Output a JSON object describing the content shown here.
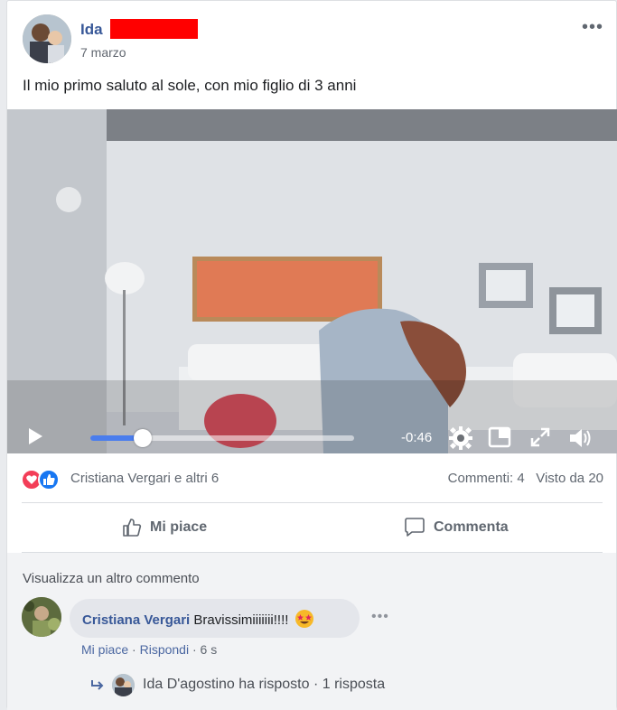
{
  "post": {
    "author": "Ida",
    "date": "7 marzo",
    "text": "Il mio primo saluto al sole, con mio figlio di 3 anni",
    "more_icon": "•••"
  },
  "video": {
    "time_remaining": "-0:46",
    "progress": 0.2,
    "icons": [
      "play-icon",
      "settings-gear-icon",
      "picture-in-picture-icon",
      "fullscreen-icon",
      "volume-icon"
    ]
  },
  "stats": {
    "reactions": [
      "love-reaction-icon",
      "like-reaction-icon"
    ],
    "reacted_by": "Cristiana Vergari e altri 6",
    "comments": "Commenti: 4",
    "views": "Visto da 20"
  },
  "actions": {
    "like": "Mi piace",
    "comment": "Commenta"
  },
  "comments": {
    "show_more": "Visualizza un altro commento",
    "items": [
      {
        "author": "Cristiana Vergari",
        "text": "Bravissimiiiiiii!!!!",
        "like": "Mi piace",
        "reply": "Rispondi",
        "time": "6 s",
        "more": "•••"
      }
    ],
    "reply_summary": "Ida D'agostino ha risposto · 1 risposta"
  },
  "colors": {
    "link": "#385898",
    "progress": "#4a7ded",
    "love": "#f33e58",
    "like": "#1877f2",
    "redaction": "#ff0000"
  }
}
